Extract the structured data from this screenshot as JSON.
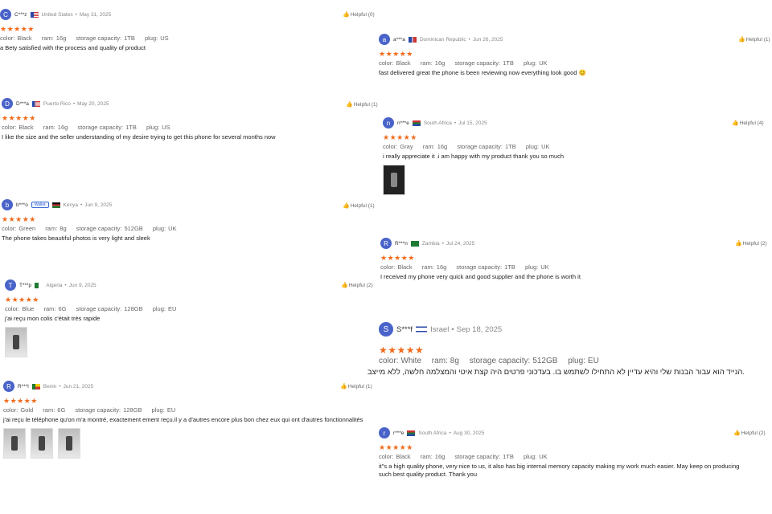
{
  "helpful_label": "Helpful",
  "reviews_left": [
    {
      "avatar": "C",
      "name": "C***z",
      "country": "United States",
      "date": "May 31, 2025",
      "helpful": "Helpful (0)",
      "stars": "★★★★★",
      "color": "Black",
      "ram": "16g",
      "storage": "1TB",
      "plug": "US",
      "text": "a Bety satisfied with the process and quality of product"
    },
    {
      "avatar": "D",
      "name": "D***a",
      "country": "Puerto Rico",
      "date": "May 20, 2025",
      "helpful": "Helpful (1)",
      "stars": "★★★★★",
      "color": "Black",
      "ram": "16g",
      "storage": "1TB",
      "plug": "US",
      "text": "I like the size and the seller understanding of my desire trying to get this phone for several months now"
    },
    {
      "avatar": "b",
      "name": "b***o",
      "badge": "Wallet",
      "country": "Kenya",
      "date": "Jun 9, 2025",
      "helpful": "Helpful (1)",
      "stars": "★★★★★",
      "color": "Green",
      "ram": "8g",
      "storage": "512GB",
      "plug": "UK",
      "text": "The phone takes beautiful photos is very light and sleek"
    },
    {
      "avatar": "T",
      "name": "T***p",
      "country": "Algeria",
      "date": "Jun 9, 2025",
      "helpful": "Helpful (2)",
      "stars": "★★★★★",
      "color": "Blue",
      "ram": "6G",
      "storage": "128GB",
      "plug": "EU",
      "text": "j'ai reçu mon colis c'était très rapide"
    },
    {
      "avatar": "R",
      "name": "R***l",
      "country": "Benin",
      "date": "Jun 21, 2025",
      "helpful": "Helpful (1)",
      "stars": "★★★★★",
      "color": "Gold",
      "ram": "6G",
      "storage": "128GB",
      "plug": "EU",
      "text": "j'ai reçu le téléphone qu'on m'a montré, exactement ement reçu.il y a d'autres encore plus bon chez eux qui ont d'autres fonctionnalités"
    }
  ],
  "reviews_right": [
    {
      "avatar": "a",
      "name": "a***a",
      "country": "Dominican Republic",
      "date": "Jun 26, 2025",
      "helpful": "Helpful (1)",
      "stars": "★★★★★",
      "color": "Black",
      "ram": "16g",
      "storage": "1TB",
      "plug": "UK",
      "text": "fast delivered great the phone is been reviewing now everything look good 😊"
    },
    {
      "avatar": "n",
      "name": "n***e",
      "country": "South Africa",
      "date": "Jul 15, 2025",
      "helpful": "Helpful (4)",
      "stars": "★★★★★",
      "color": "Gray",
      "ram": "16g",
      "storage": "1TB",
      "plug": "UK",
      "text": "i really appreciate it .i am happy with my product thank you so much"
    },
    {
      "avatar": "R",
      "name": "R***n",
      "country": "Zambia",
      "date": "Jul 24, 2025",
      "helpful": "Helpful (2)",
      "stars": "★★★★★",
      "color": "Black",
      "ram": "16g",
      "storage": "1TB",
      "plug": "UK",
      "text": "I received my phone very quick and good supplier and the phone is worth it"
    },
    {
      "avatar": "S",
      "name": "S***f",
      "country": "Israel",
      "date": "Sep 18, 2025",
      "stars": "★★★★★",
      "color": "White",
      "ram": "8g",
      "storage": "512GB",
      "plug": "EU",
      "text": ".הנייד הוא עבור הבנות שלי והיא עדיין לא התחילו לשתמש בו. בעדכוני פרטים היה קצת איטי והמצלמה חלשה, ללא מייצב"
    },
    {
      "avatar": "r",
      "name": "r***e",
      "country": "South Africa",
      "date": "Aug 30, 2025",
      "helpful": "Helpful (2)",
      "stars": "★★★★★",
      "color": "Black",
      "ram": "16g",
      "storage": "1TB",
      "plug": "UK",
      "text": "it\"s a high quality phone, very nice to us, it also has big internal memory capacity making my work much easier. May keep on producing",
      "text2": "such best quality product. Thank you"
    }
  ],
  "attr_labels": {
    "color": "color:",
    "ram": "ram:",
    "storage": "storage capacity:",
    "plug": "plug:"
  },
  "colors": {
    "star": "#f16a1b",
    "avatar": "#4a63c9"
  }
}
